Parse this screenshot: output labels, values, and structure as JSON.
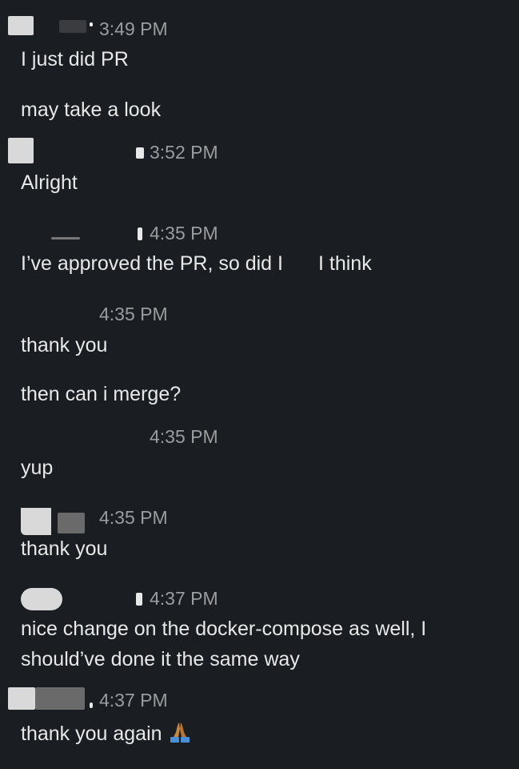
{
  "conversation": [
    {
      "time": "3:49 PM",
      "lines": [
        "I just did PR",
        "may take a look"
      ]
    },
    {
      "time": "3:52 PM",
      "lines": [
        "Alright"
      ]
    },
    {
      "time": "4:35 PM",
      "lines": [
        "I’ve approved the PR, so did I",
        "I think"
      ]
    },
    {
      "time": "4:35 PM",
      "lines": [
        "thank you",
        "then can i merge?"
      ]
    },
    {
      "time": "4:35 PM",
      "lines": [
        "yup"
      ]
    },
    {
      "time": "4:35 PM",
      "lines": [
        "thank you"
      ]
    },
    {
      "time": "4:37 PM",
      "lines": [
        "nice change on the docker-compose as well, I should’ve done it the same way"
      ]
    },
    {
      "time": "4:37 PM",
      "lines": [
        "thank you again"
      ],
      "emoji": "folded-hands-icon"
    }
  ],
  "colors": {
    "background": "#1a1d21",
    "message_text": "#e8e8e8",
    "timestamp_text": "#9b9c9e",
    "emoji_skin": "#c68642",
    "emoji_sleeve": "#4a90d9"
  }
}
